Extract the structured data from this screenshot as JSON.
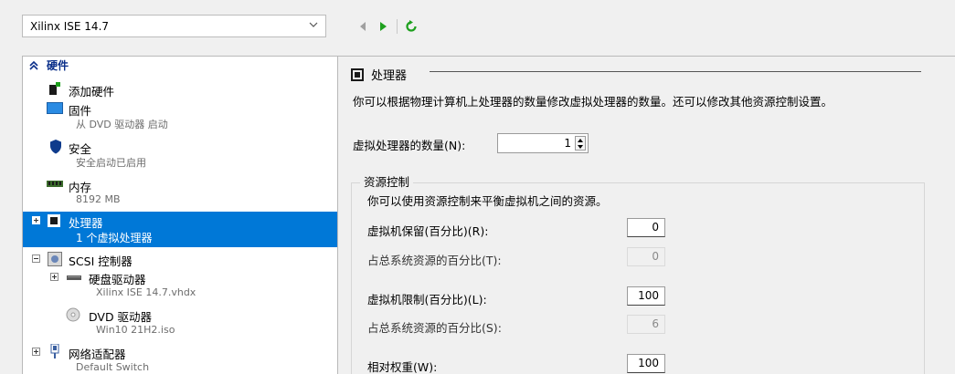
{
  "vm_selector": {
    "value": "Xilinx ISE 14.7"
  },
  "toolbar": {
    "back_icon": "triangle-left-icon",
    "forward_icon": "play-icon",
    "refresh_icon": "refresh-icon"
  },
  "hardware_section": {
    "title": "硬件"
  },
  "tree": {
    "add_hardware": "添加硬件",
    "firmware": {
      "label": "固件",
      "sub": "从 DVD 驱动器 启动"
    },
    "security": {
      "label": "安全",
      "sub": "安全启动已启用"
    },
    "memory": {
      "label": "内存",
      "sub": "8192 MB"
    },
    "processor": {
      "label": "处理器",
      "sub": "1 个虚拟处理器"
    },
    "scsi": {
      "label": "SCSI 控制器"
    },
    "hdd": {
      "label": "硬盘驱动器",
      "sub": "Xilinx ISE 14.7.vhdx"
    },
    "dvd": {
      "label": "DVD 驱动器",
      "sub": "Win10 21H2.iso"
    },
    "network": {
      "label": "网络适配器",
      "sub": "Default Switch"
    }
  },
  "right": {
    "title": "处理器",
    "description": "你可以根据物理计算机上处理器的数量修改虚拟处理器的数量。还可以修改其他资源控制设置。",
    "vproc_label": "虚拟处理器的数量(N):",
    "vproc_value": "1",
    "resource": {
      "legend": "资源控制",
      "desc": "你可以使用资源控制来平衡虚拟机之间的资源。",
      "reserve_label": "虚拟机保留(百分比)(R):",
      "reserve_value": "0",
      "reserve_pct_label": "占总系统资源的百分比(T):",
      "reserve_pct_value": "0",
      "limit_label": "虚拟机限制(百分比)(L):",
      "limit_value": "100",
      "limit_pct_label": "占总系统资源的百分比(S):",
      "limit_pct_value": "6",
      "weight_label": "相对权重(W):",
      "weight_value": "100"
    }
  },
  "colors": {
    "selection": "#0078d7",
    "header": "#0b2f8a",
    "play": "#1ea01e"
  }
}
